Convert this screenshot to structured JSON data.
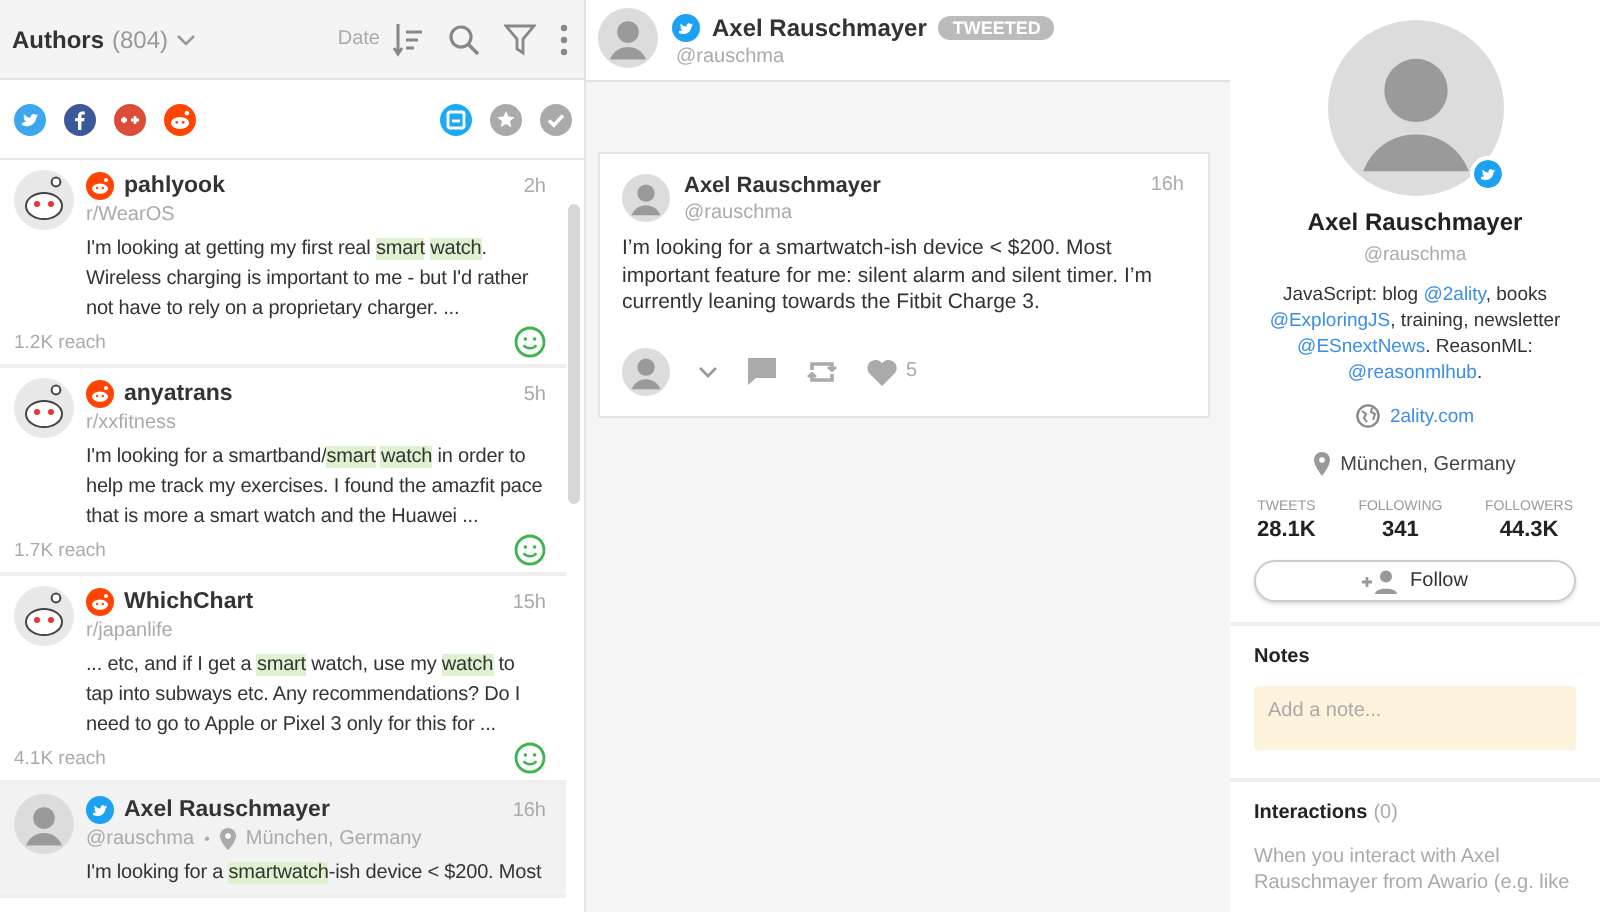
{
  "list_header": {
    "title": "Authors",
    "count": "(804)",
    "sort_label": "Date"
  },
  "mentions": [
    {
      "kind": "reddit",
      "author": "pahlyook",
      "source": "r/WearOS",
      "time": "2h",
      "selected": false,
      "body": [
        {
          "text": "I'm looking at getting my first real ",
          "highlighted": false
        },
        {
          "text": "smart",
          "highlighted": true,
          "space_after": true
        },
        {
          "text": "watch",
          "highlighted": true
        },
        {
          "text": ". Wireless charging is important to me - but I'd rather not have to rely on a proprietary charger. ...",
          "highlighted": false
        }
      ],
      "reach": "1.2K reach",
      "positive": true
    },
    {
      "kind": "reddit",
      "author": "anyatrans",
      "source": "r/xxfitness",
      "time": "5h",
      "selected": false,
      "body": [
        {
          "text": "I'm looking for a smartband/",
          "highlighted": false
        },
        {
          "text": "smart",
          "highlighted": true,
          "space_after": true
        },
        {
          "text": "watch",
          "highlighted": true
        },
        {
          "text": " in order to help me track my exercises. I found the amazfit pace that is more a smart watch and the Huawei ...",
          "highlighted": false
        }
      ],
      "reach": "1.7K reach",
      "positive": true
    },
    {
      "kind": "reddit",
      "author": "WhichChart",
      "source": "r/japanlife",
      "time": "15h",
      "selected": false,
      "body": [
        {
          "text": "... etc, and if I get a ",
          "highlighted": false
        },
        {
          "text": "smart",
          "highlighted": true
        },
        {
          "text": " watch, use my ",
          "highlighted": false
        },
        {
          "text": "watch",
          "highlighted": true
        },
        {
          "text": " to tap into subways etc. Any recommendations? Do I need to go to Apple or Pixel 3 only for this for ...",
          "highlighted": false
        }
      ],
      "reach": "4.1K reach",
      "positive": true
    },
    {
      "kind": "twitter",
      "author": "Axel Rauschmayer",
      "source": "@rauschma",
      "separator": "•",
      "location": "München, Germany",
      "time": "16h",
      "selected": true,
      "body": [
        {
          "text": "I'm looking for a ",
          "highlighted": false
        },
        {
          "text": "smartwatch",
          "highlighted": true
        },
        {
          "text": "-ish device < $200. Most",
          "highlighted": false
        }
      ]
    }
  ],
  "detail": {
    "author": "Axel Rauschmayer",
    "badge": "TWEETED",
    "handle": "@rauschma",
    "post": {
      "author": "Axel Rauschmayer",
      "handle": "@rauschma",
      "time": "16h",
      "text": "I’m looking for a smartwatch-ish device < $200. Most important feature for me: silent alarm and silent timer. I’m currently leaning towards the Fitbit Charge 3.",
      "likes": "5"
    }
  },
  "profile": {
    "name": "Axel Rauschmayer",
    "handle": "@rauschma",
    "bio": [
      {
        "kind": "text",
        "text": "JavaScript: blog "
      },
      {
        "kind": "link",
        "text": "@2ality"
      },
      {
        "kind": "text",
        "text": ", books "
      },
      {
        "kind": "link",
        "text": "@ExploringJS"
      },
      {
        "kind": "text",
        "text": ", training, newsletter "
      },
      {
        "kind": "link",
        "text": "@ESnextNews"
      },
      {
        "kind": "text",
        "text": ". ReasonML: "
      },
      {
        "kind": "link",
        "text": "@reasonmlhub"
      },
      {
        "kind": "text",
        "text": "."
      }
    ],
    "website": "2ality.com",
    "location": "München, Germany",
    "stats": [
      {
        "label": "TWEETS",
        "value": "28.1K"
      },
      {
        "label": "FOLLOWING",
        "value": "341"
      },
      {
        "label": "FOLLOWERS",
        "value": "44.3K"
      }
    ],
    "follow_button": "Follow"
  },
  "notes": {
    "title": "Notes",
    "placeholder": "Add a note..."
  },
  "interactions": {
    "title": "Interactions",
    "count": "(0)",
    "text": "When you interact with Axel Rauschmayer from Awario (e.g. like"
  }
}
